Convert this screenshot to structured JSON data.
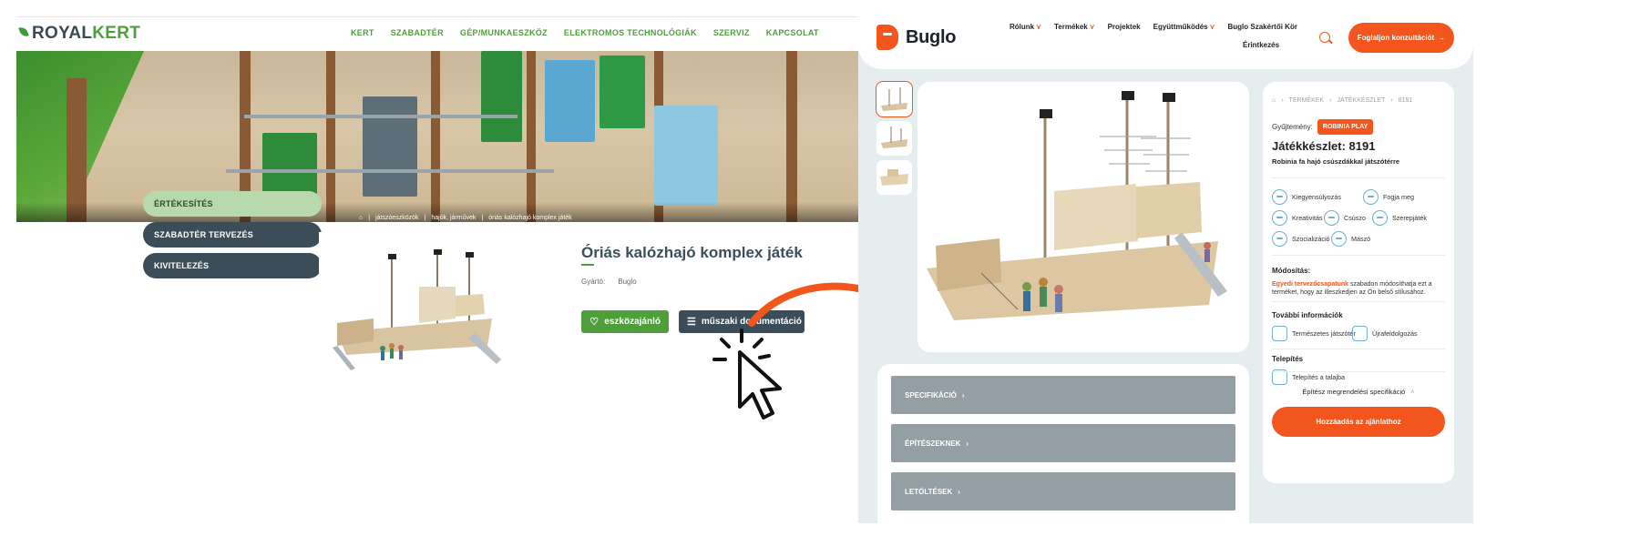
{
  "royalkert": {
    "logo": {
      "part1": "ROYAL",
      "part2": "KERT"
    },
    "nav": [
      "KERT",
      "SZABADTÉR",
      "GÉP/MUNKAESZKÖZ",
      "ELEKTROMOS TECHNOLÓGIÁK",
      "SZERVIZ",
      "KAPCSOLAT"
    ],
    "breadcrumb": [
      "játszóeszközök",
      "hajók, járművek",
      "óriás kalózhajó komplex játék"
    ],
    "sidebar": [
      {
        "label": "ÉRTÉKESÍTÉS",
        "active": true
      },
      {
        "label": "SZABADTÉR TERVEZÉS",
        "active": false
      },
      {
        "label": "KIVITELEZÉS",
        "active": false
      }
    ],
    "product": {
      "title": "Óriás kalózhajó komplex játék",
      "maker_label": "Gyártó:",
      "maker_value": "Buglo",
      "btn_compare": "eszközajánló",
      "btn_docs": "műszaki dokumentáció"
    },
    "colors": {
      "accent": "#4e9e3b",
      "dark": "#3a4d58",
      "active_bg": "#b8d9ae"
    }
  },
  "annotation": {
    "arrow_color": "#f2561d",
    "cursor": "click-pointer-icon"
  },
  "buglo": {
    "logo": "Buglo",
    "nav": [
      {
        "label": "Rólunk",
        "has_menu": true
      },
      {
        "label": "Termékek",
        "has_menu": true
      },
      {
        "label": "Projektek",
        "has_menu": false
      },
      {
        "label": "Együttműködés",
        "has_menu": true
      },
      {
        "label": "Buglo Szakértői Kör",
        "has_menu": false
      }
    ],
    "nav_row2": "Érintkezés",
    "cta": "Foglaljon konzultációt",
    "breadcrumb": [
      "TERMÉKEK",
      "JÁTÉKKÉSZLET",
      "8191"
    ],
    "collection_label": "Gyűjtemény:",
    "collection_badge": "ROBINIA PLAY",
    "title": "Játékkészlet: 8191",
    "subtitle": "Robinia fa hajó csúszdákkal játszótérre",
    "features": [
      "Kiegyensúlyozás",
      "Fogja meg",
      "Kreativitás",
      "Csúszo",
      "Szerepjáték",
      "Szocializáció",
      "Mászó"
    ],
    "mod_heading": "Módosítás:",
    "mod_link": "Egyedi tervezőcsapatunk",
    "mod_text": " szabadon módosíthatja ezt a terméket, hogy az illeszkedjen az Ön belső stílusához.",
    "more_heading": "További információk",
    "more_items": [
      "Természetes játszótér",
      "Újrafeldolgozás"
    ],
    "install_heading": "Telepítés",
    "install_item": "Telepítés a talajba",
    "spec_link": "Építész megrendelési specifikáció",
    "add_button": "Hozzáadás az ajánlathoz",
    "accordion": [
      "SPECIFIKÁCIÓ",
      "ÉPÍTÉSZEKNEK",
      "LETÖLTÉSEK"
    ],
    "colors": {
      "accent": "#f2561d",
      "bg": "#e5edef",
      "accordion": "#939fa5"
    }
  }
}
